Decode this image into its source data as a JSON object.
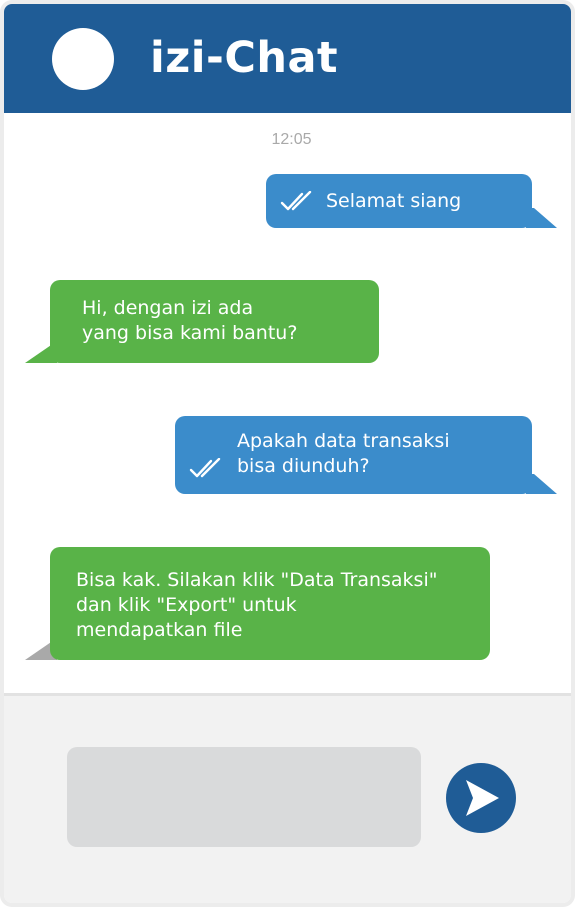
{
  "app": {
    "title": "izi-Chat"
  },
  "chat": {
    "timestamp": "12:05",
    "messages": [
      {
        "direction": "sent",
        "text": "Selamat siang",
        "status_icon": "double-check-icon"
      },
      {
        "direction": "received",
        "text": "Hi, dengan izi ada\nyang bisa kami bantu?"
      },
      {
        "direction": "sent",
        "text": "Apakah data transaksi\nbisa diunduh?",
        "status_icon": "double-check-icon"
      },
      {
        "direction": "received",
        "text": "Bisa kak. Silakan klik \"Data Transaksi\"\ndan klik \"Export\" untuk\nmendapatkan file"
      }
    ]
  },
  "composer": {
    "input_value": "",
    "send_icon": "send-icon"
  },
  "colors": {
    "header": "#1f5c96",
    "sent_bubble": "#3b8ccb",
    "received_bubble": "#59b348",
    "composer_bg": "#f2f2f2",
    "input_bg": "#d9dadb"
  }
}
